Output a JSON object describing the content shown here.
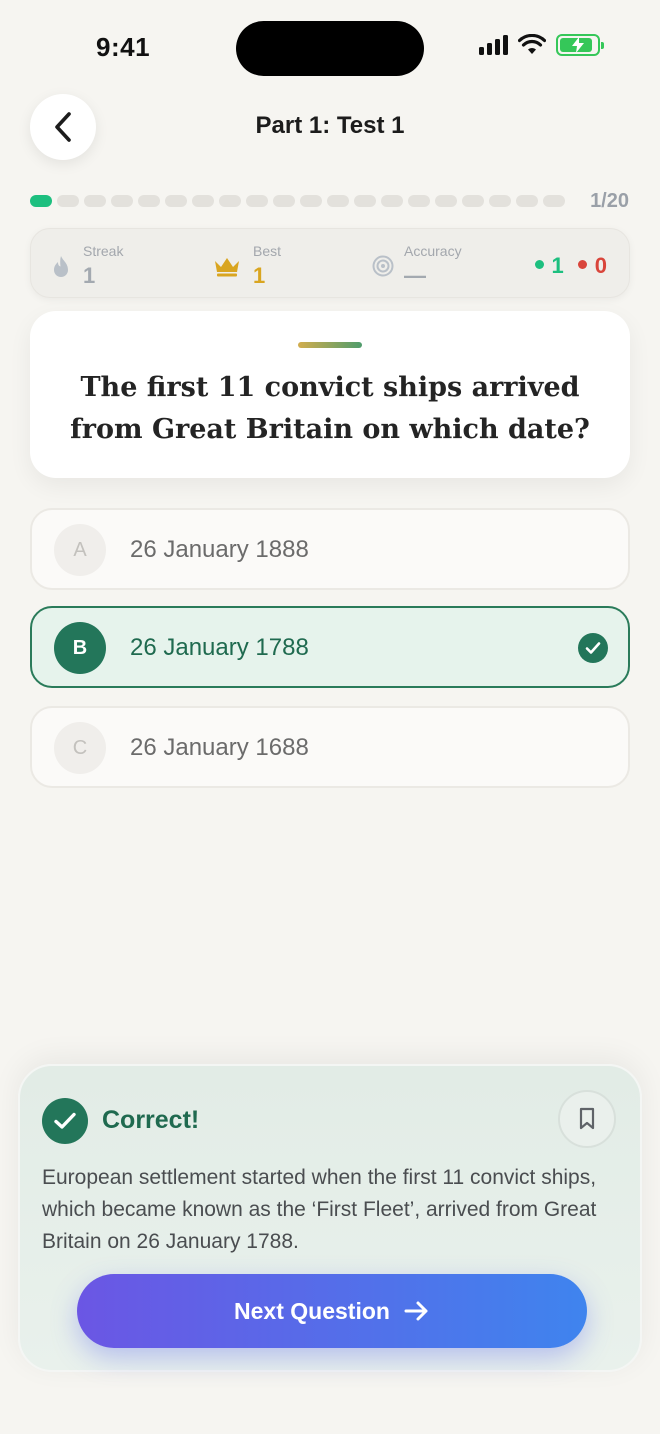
{
  "status_bar": {
    "time": "9:41"
  },
  "header": {
    "title": "Part 1: Test 1"
  },
  "progress": {
    "current": 1,
    "total": 20,
    "label": "1/20"
  },
  "stats": {
    "streak": {
      "label": "Streak",
      "value": "1"
    },
    "best": {
      "label": "Best",
      "value": "1"
    },
    "accuracy": {
      "label": "Accuracy",
      "value": "—"
    },
    "correct_count": "1",
    "wrong_count": "0"
  },
  "question": {
    "text": "The first 11 convict ships arrived from Great Britain on which date?"
  },
  "options": [
    {
      "letter": "A",
      "text": "26 January 1888",
      "state": "default"
    },
    {
      "letter": "B",
      "text": "26 January 1788",
      "state": "correct"
    },
    {
      "letter": "C",
      "text": "26 January 1688",
      "state": "default"
    }
  ],
  "feedback": {
    "title": "Correct!",
    "explanation": "European settlement started when the first 11 convict ships, which became known as the ‘First Fleet’, arrived from Great Britain on 26 January 1788.",
    "next_label": "Next Question"
  },
  "colors": {
    "accent_green": "#23765a",
    "progress_active": "#1dbf7f",
    "best_gold": "#d9a520",
    "wrong_red": "#d9453b",
    "button_gradient": [
      "#6b56e4",
      "#3f84ee"
    ]
  }
}
